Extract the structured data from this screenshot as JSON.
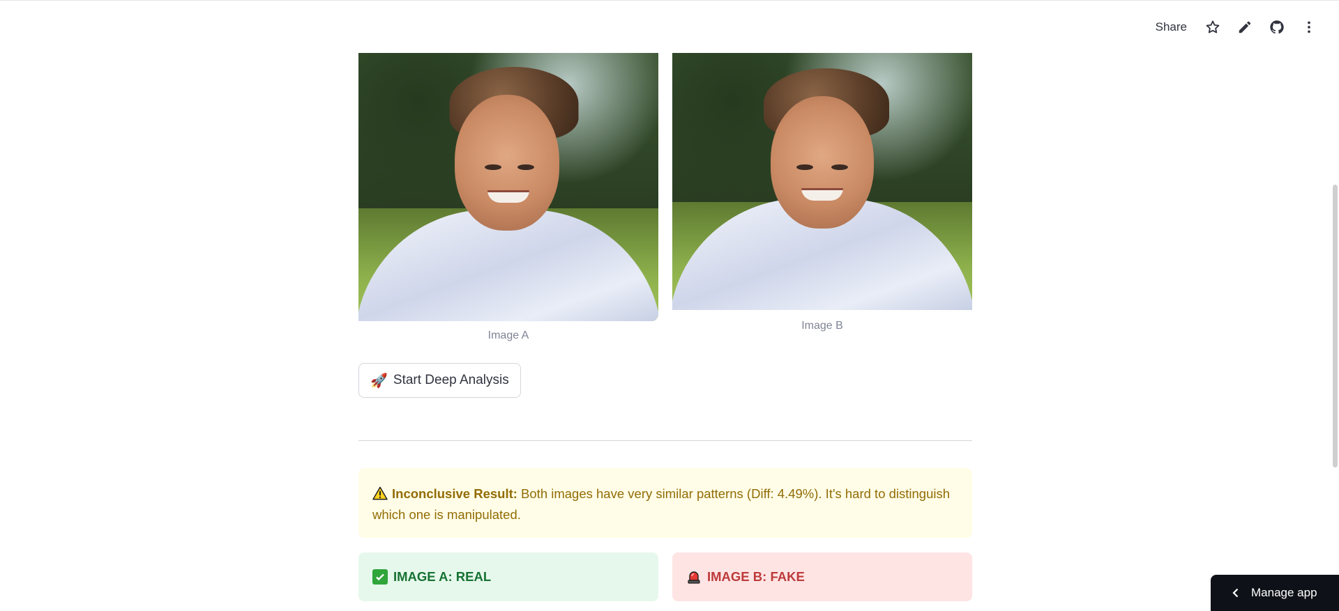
{
  "toolbar": {
    "share_label": "Share",
    "icons": [
      "star-icon",
      "pencil-icon",
      "github-icon",
      "more-vertical-icon"
    ]
  },
  "images": {
    "a": {
      "caption": "Image A"
    },
    "b": {
      "caption": "Image B"
    }
  },
  "analysis_button": {
    "icon": "rocket-icon",
    "label": "Start Deep Analysis"
  },
  "alert": {
    "icon": "warning-icon",
    "title": "Inconclusive Result:",
    "message": " Both images have very similar patterns (Diff: 4.49%). It's hard to distinguish which one is manipulated."
  },
  "results": {
    "a": {
      "icon": "check-icon",
      "label": "IMAGE A: REAL",
      "color": "#177233",
      "bg": "#e6f8ec"
    },
    "b": {
      "icon": "siren-icon",
      "label": "IMAGE B: FAKE",
      "color": "#bd3a3a",
      "bg": "#ffe4e4"
    }
  },
  "manage_app": {
    "label": "Manage app"
  }
}
